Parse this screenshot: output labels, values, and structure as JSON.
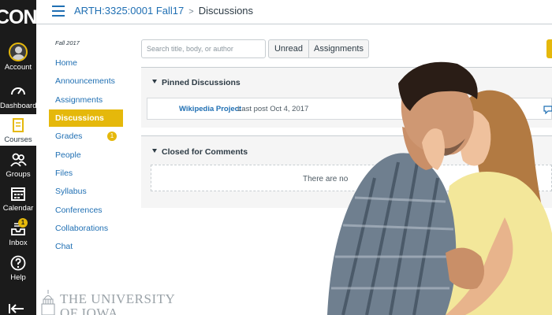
{
  "global_nav": {
    "logo_text": "CON",
    "items": [
      {
        "label": "Account",
        "icon": "account-avatar"
      },
      {
        "label": "Dashboard",
        "icon": "speedometer-icon"
      },
      {
        "label": "Courses",
        "icon": "book-icon"
      },
      {
        "label": "Groups",
        "icon": "people-icon"
      },
      {
        "label": "Calendar",
        "icon": "calendar-icon"
      },
      {
        "label": "Inbox",
        "icon": "inbox-icon",
        "badge": "1"
      },
      {
        "label": "Help",
        "icon": "help-icon"
      }
    ],
    "accent_color": "#e5b80b"
  },
  "header": {
    "course": "ARTH:3325:0001 Fall17",
    "page": "Discussions"
  },
  "course_nav": {
    "term": "Fall 2017",
    "items": [
      {
        "label": "Home"
      },
      {
        "label": "Announcements"
      },
      {
        "label": "Assignments"
      },
      {
        "label": "Discussions",
        "active": true
      },
      {
        "label": "Grades",
        "badge": "1"
      },
      {
        "label": "People"
      },
      {
        "label": "Files"
      },
      {
        "label": "Syllabus"
      },
      {
        "label": "Conferences"
      },
      {
        "label": "Collaborations"
      },
      {
        "label": "Chat"
      }
    ]
  },
  "toolbar": {
    "search_placeholder": "Search title, body, or author",
    "unread_label": "Unread",
    "assignments_label": "Assignments"
  },
  "pinned": {
    "heading": "Pinned Discussions",
    "rows": [
      {
        "title": "Wikipedia Project",
        "meta": "Last post Oct 4, 2017"
      }
    ]
  },
  "closed": {
    "heading": "Closed for Comments",
    "empty_text": "There are no"
  },
  "university": {
    "line1": "THE UNIVERSITY",
    "line2": "OF IOWA"
  }
}
